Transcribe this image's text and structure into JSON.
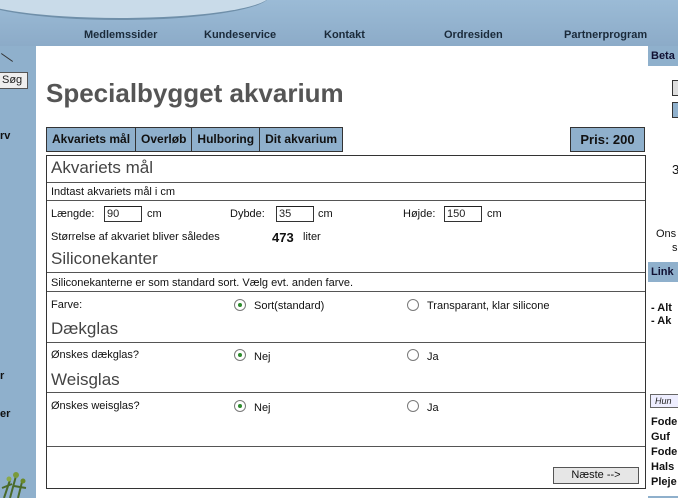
{
  "nav": {
    "items": [
      "Medlemssider",
      "Kundeservice",
      "Kontakt",
      "Ordresiden",
      "Partnerprogram"
    ]
  },
  "left": {
    "search_label": "Søg",
    "frag1": "rv",
    "frag2": "r",
    "frag3": "er"
  },
  "page": {
    "title": "Specialbygget akvarium",
    "tabs": [
      "Akvariets mål",
      "Overløb",
      "Hulboring",
      "Dit akvarium"
    ],
    "price": "Pris: 200"
  },
  "form": {
    "dims": {
      "heading": "Akvariets mål",
      "instruction": "Indtast akvariets mål i cm",
      "length_label": "Længde:",
      "length_value": "90",
      "depth_label": "Dybde:",
      "depth_value": "35",
      "height_label": "Højde:",
      "height_value": "150",
      "unit": "cm",
      "size_text": "Størrelse af akvariet bliver således",
      "size_value": "473",
      "size_unit": "liter"
    },
    "silicone": {
      "heading": "Siliconekanter",
      "instruction": "Siliconekanterne er som standard sort. Vælg evt. anden farve.",
      "label": "Farve:",
      "opt1": "Sort(standard)",
      "opt2": "Transparant, klar silicone"
    },
    "cover": {
      "heading": "Dækglas",
      "question": "Ønskes dækglas?",
      "opt1": "Nej",
      "opt2": "Ja"
    },
    "weir": {
      "heading": "Weisglas",
      "question": "Ønskes weisglas?",
      "opt1": "Nej",
      "opt2": "Ja"
    },
    "next_label": "Næste -->"
  },
  "right": {
    "head": "Beta",
    "frag_3": "3",
    "frag_ons": "Ons",
    "frag_s": "s",
    "links_head": "Link",
    "link1": "- Alt",
    "link2": "- Ak",
    "hun": "Hun",
    "items": [
      "Fode",
      "Guf",
      "Fode",
      "Hals",
      "Pleje"
    ]
  },
  "colors": {
    "panel": "#8fb0cc",
    "radio_selected": "#2e8b2e"
  }
}
